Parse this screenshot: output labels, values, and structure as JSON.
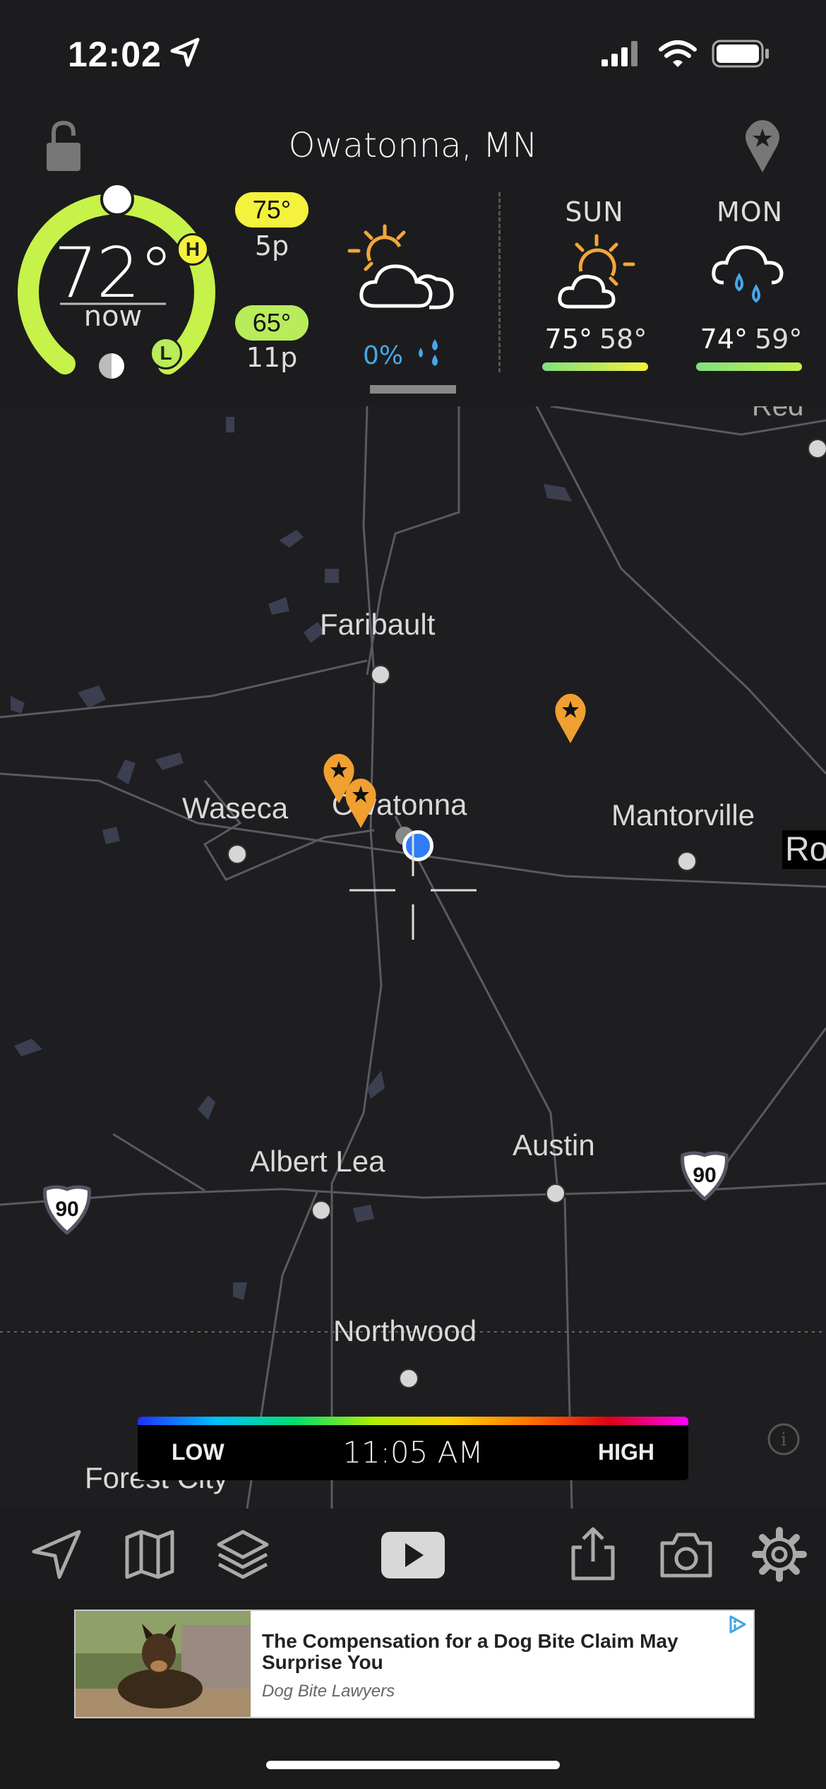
{
  "status_bar": {
    "time": "12:02"
  },
  "header": {
    "location": "Owatonna, MN"
  },
  "current": {
    "temp": "72°",
    "label": "now",
    "high_badge": "H",
    "low_badge": "L",
    "high": {
      "temp": "75°",
      "time": "5p"
    },
    "low": {
      "temp": "65°",
      "time": "11p"
    },
    "precip": "0%"
  },
  "forecast": [
    {
      "day": "SUN",
      "high": "75°",
      "low": "58°"
    },
    {
      "day": "MON",
      "high": "74°",
      "low": "59°"
    }
  ],
  "map": {
    "cities": [
      "Faribault",
      "Waseca",
      "Owatonna",
      "Mantorville",
      "Albert Lea",
      "Austin",
      "Northwood",
      "Forest City",
      "Ro",
      "Red"
    ],
    "highway_shields": [
      "90",
      "90"
    ]
  },
  "legend": {
    "low": "LOW",
    "time": "11:05 AM",
    "high": "HIGH"
  },
  "ad": {
    "title": "The Compensation for a Dog Bite Claim May Surprise You",
    "source": "Dog Bite Lawyers"
  },
  "colors": {
    "ring_green": "#c6f24a",
    "high_yellow": "#f4f23c",
    "low_green": "#b8ec5a",
    "marker_orange": "#f0a030",
    "location_blue": "#2f7cf6",
    "sun_orange": "#f2a63a",
    "rain_blue": "#45a8e8"
  }
}
